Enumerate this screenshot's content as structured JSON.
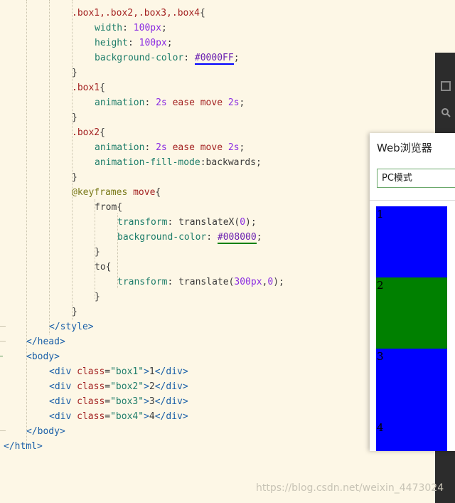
{
  "code": {
    "lines": [
      [
        {
          "t": ".box1,.box2,.box3,.box4",
          "c": "sel"
        },
        {
          "t": "{",
          "c": "punc"
        }
      ],
      [
        {
          "t": "width",
          "c": "prop"
        },
        {
          "t": ": ",
          "c": "punc"
        },
        {
          "t": "100px",
          "c": "num"
        },
        {
          "t": ";",
          "c": "punc"
        }
      ],
      [
        {
          "t": "height",
          "c": "prop"
        },
        {
          "t": ": ",
          "c": "punc"
        },
        {
          "t": "100px",
          "c": "num"
        },
        {
          "t": ";",
          "c": "punc"
        }
      ],
      [
        {
          "t": "background-color",
          "c": "prop"
        },
        {
          "t": ": ",
          "c": "punc"
        },
        {
          "t": "#0000FF",
          "c": "color",
          "u": "#0000ff"
        },
        {
          "t": ";",
          "c": "punc"
        }
      ],
      [
        {
          "t": "}",
          "c": "punc"
        }
      ],
      [
        {
          "t": ".box1",
          "c": "sel"
        },
        {
          "t": "{",
          "c": "punc"
        }
      ],
      [
        {
          "t": "animation",
          "c": "prop"
        },
        {
          "t": ": ",
          "c": "punc"
        },
        {
          "t": "2s",
          "c": "num"
        },
        {
          "t": " ",
          "c": "punc"
        },
        {
          "t": "ease",
          "c": "kw"
        },
        {
          "t": " ",
          "c": "punc"
        },
        {
          "t": "move",
          "c": "kw"
        },
        {
          "t": " ",
          "c": "punc"
        },
        {
          "t": "2s",
          "c": "num"
        },
        {
          "t": ";",
          "c": "punc"
        }
      ],
      [
        {
          "t": "}",
          "c": "punc"
        }
      ],
      [
        {
          "t": ".box2",
          "c": "sel"
        },
        {
          "t": "{",
          "c": "punc"
        }
      ],
      [
        {
          "t": "animation",
          "c": "prop"
        },
        {
          "t": ": ",
          "c": "punc"
        },
        {
          "t": "2s",
          "c": "num"
        },
        {
          "t": " ",
          "c": "punc"
        },
        {
          "t": "ease",
          "c": "kw"
        },
        {
          "t": " ",
          "c": "punc"
        },
        {
          "t": "move",
          "c": "kw"
        },
        {
          "t": " ",
          "c": "punc"
        },
        {
          "t": "2s",
          "c": "num"
        },
        {
          "t": ";",
          "c": "punc"
        }
      ],
      [
        {
          "t": "animation-fill-mode",
          "c": "prop"
        },
        {
          "t": ":",
          "c": "punc"
        },
        {
          "t": "backwards",
          "c": "text"
        },
        {
          "t": ";",
          "c": "punc"
        }
      ],
      [
        {
          "t": "}",
          "c": "punc"
        }
      ],
      [
        {
          "t": "@keyframes",
          "c": "at"
        },
        {
          "t": " ",
          "c": "punc"
        },
        {
          "t": "move",
          "c": "kw"
        },
        {
          "t": "{",
          "c": "punc"
        }
      ],
      [
        {
          "t": "from",
          "c": "text"
        },
        {
          "t": "{",
          "c": "punc"
        }
      ],
      [
        {
          "t": "transform",
          "c": "prop"
        },
        {
          "t": ": ",
          "c": "punc"
        },
        {
          "t": "translateX(",
          "c": "text"
        },
        {
          "t": "0",
          "c": "num"
        },
        {
          "t": ");",
          "c": "punc"
        }
      ],
      [
        {
          "t": "background-color",
          "c": "prop"
        },
        {
          "t": ": ",
          "c": "punc"
        },
        {
          "t": "#008000",
          "c": "color",
          "u": "#008000"
        },
        {
          "t": ";",
          "c": "punc"
        }
      ],
      [
        {
          "t": "}",
          "c": "punc"
        }
      ],
      [
        {
          "t": "to",
          "c": "text"
        },
        {
          "t": "{",
          "c": "punc"
        }
      ],
      [
        {
          "t": "transform",
          "c": "prop"
        },
        {
          "t": ": ",
          "c": "punc"
        },
        {
          "t": "translate(",
          "c": "text"
        },
        {
          "t": "300px",
          "c": "num"
        },
        {
          "t": ",",
          "c": "punc"
        },
        {
          "t": "0",
          "c": "num"
        },
        {
          "t": ");",
          "c": "punc"
        }
      ],
      [
        {
          "t": "}",
          "c": "punc"
        }
      ],
      [
        {
          "t": "}",
          "c": "punc"
        }
      ],
      [
        {
          "t": "</",
          "c": "tag"
        },
        {
          "t": "style",
          "c": "tag"
        },
        {
          "t": ">",
          "c": "tag"
        }
      ],
      [
        {
          "t": "</",
          "c": "tag"
        },
        {
          "t": "head",
          "c": "tag"
        },
        {
          "t": ">",
          "c": "tag"
        }
      ],
      [
        {
          "t": "<",
          "c": "tag"
        },
        {
          "t": "body",
          "c": "tag"
        },
        {
          "t": ">",
          "c": "tag"
        }
      ],
      [
        {
          "t": "<div",
          "c": "tag"
        },
        {
          "t": " ",
          "c": "punc"
        },
        {
          "t": "class",
          "c": "attr"
        },
        {
          "t": "=",
          "c": "punc"
        },
        {
          "t": "\"box1\"",
          "c": "str"
        },
        {
          "t": ">",
          "c": "tag"
        },
        {
          "t": "1",
          "c": "text"
        },
        {
          "t": "</div>",
          "c": "tag"
        }
      ],
      [
        {
          "t": "<div",
          "c": "tag"
        },
        {
          "t": " ",
          "c": "punc"
        },
        {
          "t": "class",
          "c": "attr"
        },
        {
          "t": "=",
          "c": "punc"
        },
        {
          "t": "\"box2\"",
          "c": "str"
        },
        {
          "t": ">",
          "c": "tag"
        },
        {
          "t": "2",
          "c": "text"
        },
        {
          "t": "</div>",
          "c": "tag"
        }
      ],
      [
        {
          "t": "<div",
          "c": "tag"
        },
        {
          "t": " ",
          "c": "punc"
        },
        {
          "t": "class",
          "c": "attr"
        },
        {
          "t": "=",
          "c": "punc"
        },
        {
          "t": "\"box3\"",
          "c": "str"
        },
        {
          "t": ">",
          "c": "tag"
        },
        {
          "t": "3",
          "c": "text"
        },
        {
          "t": "</div>",
          "c": "tag"
        }
      ],
      [
        {
          "t": "<div",
          "c": "tag"
        },
        {
          "t": " ",
          "c": "punc"
        },
        {
          "t": "class",
          "c": "attr"
        },
        {
          "t": "=",
          "c": "punc"
        },
        {
          "t": "\"box4\"",
          "c": "str"
        },
        {
          "t": ">",
          "c": "tag"
        },
        {
          "t": "4",
          "c": "text"
        },
        {
          "t": "</div>",
          "c": "tag"
        }
      ],
      [
        {
          "t": "</",
          "c": "tag"
        },
        {
          "t": "body",
          "c": "tag"
        },
        {
          "t": ">",
          "c": "tag"
        }
      ],
      [
        {
          "t": "</",
          "c": "tag"
        },
        {
          "t": "html",
          "c": "tag"
        },
        {
          "t": ">",
          "c": "tag"
        }
      ]
    ]
  },
  "browser": {
    "title": "Web浏览器",
    "mode": "PC模式",
    "boxes": [
      {
        "label": "1",
        "color": "#0000ff"
      },
      {
        "label": "2",
        "color": "#008000"
      },
      {
        "label": "3",
        "color": "#0000ff"
      },
      {
        "label": "4",
        "color": "#0000ff"
      }
    ]
  },
  "watermark": "https://blog.csdn.net/weixin_4473024"
}
